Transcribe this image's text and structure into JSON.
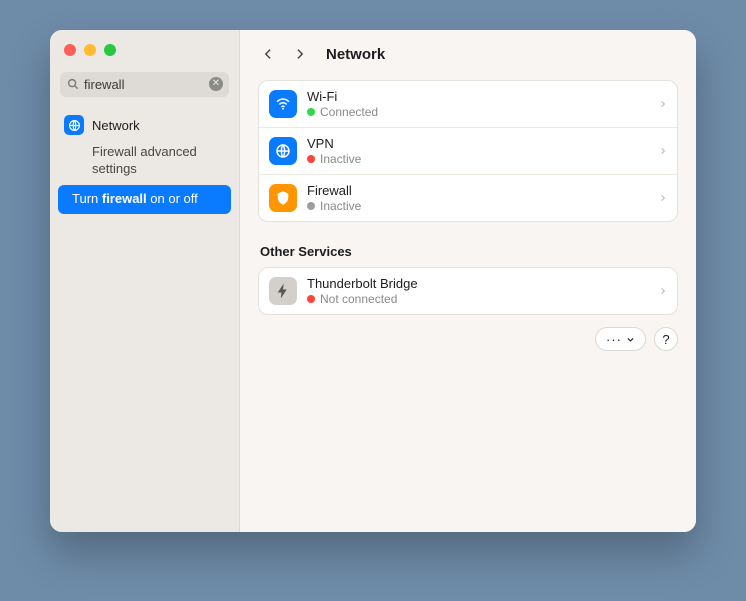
{
  "search": {
    "value": "firewall",
    "placeholder": "Search"
  },
  "sidebar": {
    "header": "Network",
    "results": [
      {
        "label": "Firewall advanced settings"
      },
      {
        "prefix": "Turn ",
        "bold": "firewall",
        "suffix": " on or off"
      }
    ]
  },
  "page": {
    "title": "Network"
  },
  "services": [
    {
      "name": "Wi-Fi",
      "status": "Connected",
      "dot": "green",
      "icon": "wifi",
      "color": "blue"
    },
    {
      "name": "VPN",
      "status": "Inactive",
      "dot": "red",
      "icon": "globe",
      "color": "blue"
    },
    {
      "name": "Firewall",
      "status": "Inactive",
      "dot": "grey",
      "icon": "shield",
      "color": "orange"
    }
  ],
  "other_label": "Other Services",
  "other": [
    {
      "name": "Thunderbolt Bridge",
      "status": "Not connected",
      "dot": "red",
      "icon": "bolt",
      "color": "grey"
    }
  ],
  "footer": {
    "more": "···",
    "help": "?"
  }
}
